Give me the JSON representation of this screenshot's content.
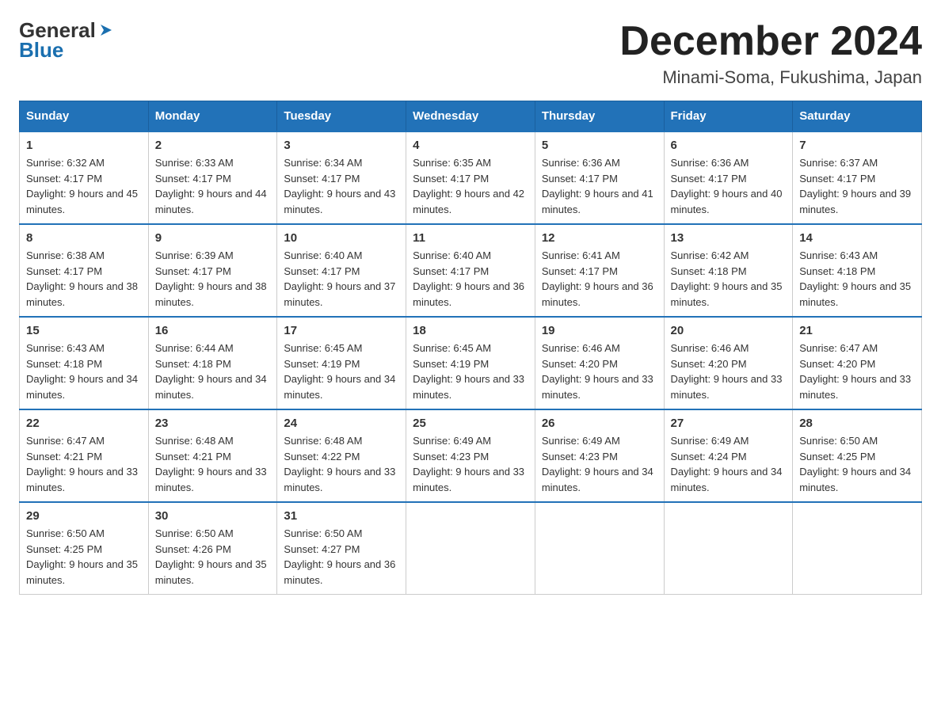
{
  "header": {
    "logo_general": "General",
    "logo_blue": "Blue",
    "calendar_title": "December 2024",
    "calendar_subtitle": "Minami-Soma, Fukushima, Japan"
  },
  "days_of_week": [
    "Sunday",
    "Monday",
    "Tuesday",
    "Wednesday",
    "Thursday",
    "Friday",
    "Saturday"
  ],
  "weeks": [
    [
      {
        "day": "1",
        "sunrise": "Sunrise: 6:32 AM",
        "sunset": "Sunset: 4:17 PM",
        "daylight": "Daylight: 9 hours and 45 minutes."
      },
      {
        "day": "2",
        "sunrise": "Sunrise: 6:33 AM",
        "sunset": "Sunset: 4:17 PM",
        "daylight": "Daylight: 9 hours and 44 minutes."
      },
      {
        "day": "3",
        "sunrise": "Sunrise: 6:34 AM",
        "sunset": "Sunset: 4:17 PM",
        "daylight": "Daylight: 9 hours and 43 minutes."
      },
      {
        "day": "4",
        "sunrise": "Sunrise: 6:35 AM",
        "sunset": "Sunset: 4:17 PM",
        "daylight": "Daylight: 9 hours and 42 minutes."
      },
      {
        "day": "5",
        "sunrise": "Sunrise: 6:36 AM",
        "sunset": "Sunset: 4:17 PM",
        "daylight": "Daylight: 9 hours and 41 minutes."
      },
      {
        "day": "6",
        "sunrise": "Sunrise: 6:36 AM",
        "sunset": "Sunset: 4:17 PM",
        "daylight": "Daylight: 9 hours and 40 minutes."
      },
      {
        "day": "7",
        "sunrise": "Sunrise: 6:37 AM",
        "sunset": "Sunset: 4:17 PM",
        "daylight": "Daylight: 9 hours and 39 minutes."
      }
    ],
    [
      {
        "day": "8",
        "sunrise": "Sunrise: 6:38 AM",
        "sunset": "Sunset: 4:17 PM",
        "daylight": "Daylight: 9 hours and 38 minutes."
      },
      {
        "day": "9",
        "sunrise": "Sunrise: 6:39 AM",
        "sunset": "Sunset: 4:17 PM",
        "daylight": "Daylight: 9 hours and 38 minutes."
      },
      {
        "day": "10",
        "sunrise": "Sunrise: 6:40 AM",
        "sunset": "Sunset: 4:17 PM",
        "daylight": "Daylight: 9 hours and 37 minutes."
      },
      {
        "day": "11",
        "sunrise": "Sunrise: 6:40 AM",
        "sunset": "Sunset: 4:17 PM",
        "daylight": "Daylight: 9 hours and 36 minutes."
      },
      {
        "day": "12",
        "sunrise": "Sunrise: 6:41 AM",
        "sunset": "Sunset: 4:17 PM",
        "daylight": "Daylight: 9 hours and 36 minutes."
      },
      {
        "day": "13",
        "sunrise": "Sunrise: 6:42 AM",
        "sunset": "Sunset: 4:18 PM",
        "daylight": "Daylight: 9 hours and 35 minutes."
      },
      {
        "day": "14",
        "sunrise": "Sunrise: 6:43 AM",
        "sunset": "Sunset: 4:18 PM",
        "daylight": "Daylight: 9 hours and 35 minutes."
      }
    ],
    [
      {
        "day": "15",
        "sunrise": "Sunrise: 6:43 AM",
        "sunset": "Sunset: 4:18 PM",
        "daylight": "Daylight: 9 hours and 34 minutes."
      },
      {
        "day": "16",
        "sunrise": "Sunrise: 6:44 AM",
        "sunset": "Sunset: 4:18 PM",
        "daylight": "Daylight: 9 hours and 34 minutes."
      },
      {
        "day": "17",
        "sunrise": "Sunrise: 6:45 AM",
        "sunset": "Sunset: 4:19 PM",
        "daylight": "Daylight: 9 hours and 34 minutes."
      },
      {
        "day": "18",
        "sunrise": "Sunrise: 6:45 AM",
        "sunset": "Sunset: 4:19 PM",
        "daylight": "Daylight: 9 hours and 33 minutes."
      },
      {
        "day": "19",
        "sunrise": "Sunrise: 6:46 AM",
        "sunset": "Sunset: 4:20 PM",
        "daylight": "Daylight: 9 hours and 33 minutes."
      },
      {
        "day": "20",
        "sunrise": "Sunrise: 6:46 AM",
        "sunset": "Sunset: 4:20 PM",
        "daylight": "Daylight: 9 hours and 33 minutes."
      },
      {
        "day": "21",
        "sunrise": "Sunrise: 6:47 AM",
        "sunset": "Sunset: 4:20 PM",
        "daylight": "Daylight: 9 hours and 33 minutes."
      }
    ],
    [
      {
        "day": "22",
        "sunrise": "Sunrise: 6:47 AM",
        "sunset": "Sunset: 4:21 PM",
        "daylight": "Daylight: 9 hours and 33 minutes."
      },
      {
        "day": "23",
        "sunrise": "Sunrise: 6:48 AM",
        "sunset": "Sunset: 4:21 PM",
        "daylight": "Daylight: 9 hours and 33 minutes."
      },
      {
        "day": "24",
        "sunrise": "Sunrise: 6:48 AM",
        "sunset": "Sunset: 4:22 PM",
        "daylight": "Daylight: 9 hours and 33 minutes."
      },
      {
        "day": "25",
        "sunrise": "Sunrise: 6:49 AM",
        "sunset": "Sunset: 4:23 PM",
        "daylight": "Daylight: 9 hours and 33 minutes."
      },
      {
        "day": "26",
        "sunrise": "Sunrise: 6:49 AM",
        "sunset": "Sunset: 4:23 PM",
        "daylight": "Daylight: 9 hours and 34 minutes."
      },
      {
        "day": "27",
        "sunrise": "Sunrise: 6:49 AM",
        "sunset": "Sunset: 4:24 PM",
        "daylight": "Daylight: 9 hours and 34 minutes."
      },
      {
        "day": "28",
        "sunrise": "Sunrise: 6:50 AM",
        "sunset": "Sunset: 4:25 PM",
        "daylight": "Daylight: 9 hours and 34 minutes."
      }
    ],
    [
      {
        "day": "29",
        "sunrise": "Sunrise: 6:50 AM",
        "sunset": "Sunset: 4:25 PM",
        "daylight": "Daylight: 9 hours and 35 minutes."
      },
      {
        "day": "30",
        "sunrise": "Sunrise: 6:50 AM",
        "sunset": "Sunset: 4:26 PM",
        "daylight": "Daylight: 9 hours and 35 minutes."
      },
      {
        "day": "31",
        "sunrise": "Sunrise: 6:50 AM",
        "sunset": "Sunset: 4:27 PM",
        "daylight": "Daylight: 9 hours and 36 minutes."
      },
      null,
      null,
      null,
      null
    ]
  ]
}
